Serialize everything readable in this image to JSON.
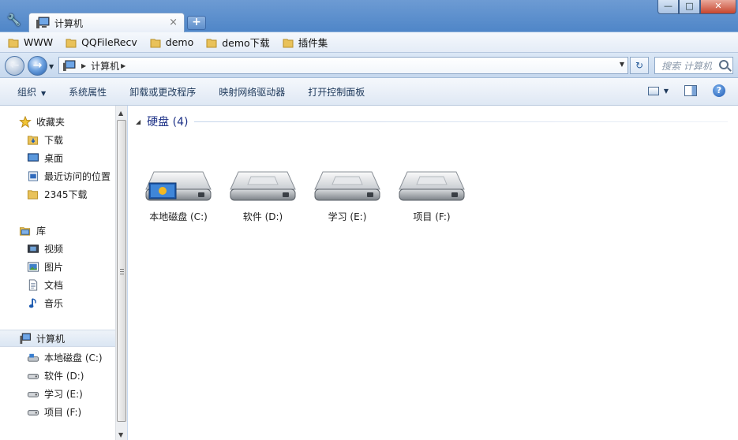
{
  "window": {
    "tab_title": "计算机",
    "tab_close": "×",
    "new_tab": "+",
    "controls": {
      "minimize": "—",
      "maximize": "□",
      "close": "✕"
    }
  },
  "bookmarks": [
    "WWW",
    "QQFileRecv",
    "demo",
    "demo下载",
    "插件集"
  ],
  "address": {
    "path": "计算机",
    "search_placeholder": "搜索 计算机"
  },
  "toolbar": {
    "organize": "组织",
    "system_properties": "系统属性",
    "uninstall": "卸载或更改程序",
    "map_drive": "映射网络驱动器",
    "control_panel": "打开控制面板"
  },
  "sidebar": {
    "favorites": {
      "label": "收藏夹",
      "items": [
        "下载",
        "桌面",
        "最近访问的位置",
        "2345下载"
      ]
    },
    "libraries": {
      "label": "库",
      "items": [
        "视频",
        "图片",
        "文档",
        "音乐"
      ]
    },
    "computer": {
      "label": "计算机",
      "items": [
        "本地磁盘 (C:)",
        "软件 (D:)",
        "学习 (E:)",
        "项目 (F:)"
      ]
    }
  },
  "main": {
    "section_title": "硬盘 (4)",
    "drives": [
      {
        "label": "本地磁盘 (C:)",
        "system": true
      },
      {
        "label": "软件 (D:)",
        "system": false
      },
      {
        "label": "学习 (E:)",
        "system": false
      },
      {
        "label": "项目 (F:)",
        "system": false
      }
    ]
  }
}
